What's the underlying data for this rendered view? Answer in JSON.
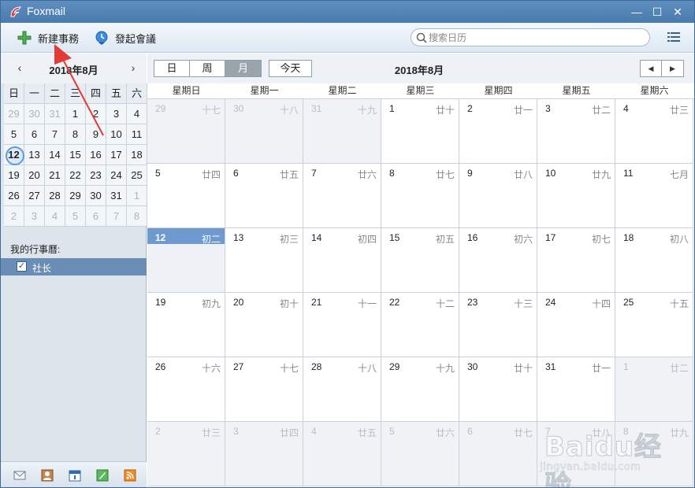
{
  "window": {
    "title": "Foxmail",
    "minimize": "—",
    "maximize": "☐",
    "close": "✕"
  },
  "toolbar": {
    "new_event": "新建事務",
    "start_meeting": "發起會議",
    "search_placeholder": "搜索日历"
  },
  "mini_calendar": {
    "title": "2018年8月",
    "prev": "‹",
    "next": "›",
    "weekdays": [
      "日",
      "一",
      "二",
      "三",
      "四",
      "五",
      "六"
    ],
    "weeks": [
      [
        {
          "d": "29",
          "o": true
        },
        {
          "d": "30",
          "o": true
        },
        {
          "d": "31",
          "o": true
        },
        {
          "d": "1"
        },
        {
          "d": "2"
        },
        {
          "d": "3"
        },
        {
          "d": "4"
        }
      ],
      [
        {
          "d": "5"
        },
        {
          "d": "6"
        },
        {
          "d": "7"
        },
        {
          "d": "8"
        },
        {
          "d": "9"
        },
        {
          "d": "10"
        },
        {
          "d": "11"
        }
      ],
      [
        {
          "d": "12",
          "t": true
        },
        {
          "d": "13"
        },
        {
          "d": "14"
        },
        {
          "d": "15"
        },
        {
          "d": "16"
        },
        {
          "d": "17"
        },
        {
          "d": "18"
        }
      ],
      [
        {
          "d": "19"
        },
        {
          "d": "20"
        },
        {
          "d": "21"
        },
        {
          "d": "22"
        },
        {
          "d": "23"
        },
        {
          "d": "24"
        },
        {
          "d": "25"
        }
      ],
      [
        {
          "d": "26"
        },
        {
          "d": "27"
        },
        {
          "d": "28"
        },
        {
          "d": "29"
        },
        {
          "d": "30"
        },
        {
          "d": "31"
        },
        {
          "d": "1",
          "o": true
        }
      ],
      [
        {
          "d": "2",
          "o": true
        },
        {
          "d": "3",
          "o": true
        },
        {
          "d": "4",
          "o": true
        },
        {
          "d": "5",
          "o": true
        },
        {
          "d": "6",
          "o": true
        },
        {
          "d": "7",
          "o": true
        },
        {
          "d": "8",
          "o": true
        }
      ]
    ]
  },
  "calendars": {
    "section_label": "我的行事曆:",
    "items": [
      {
        "label": "社长",
        "checked": true
      }
    ]
  },
  "view": {
    "day": "日",
    "week": "周",
    "month": "月",
    "today": "今天",
    "active": "month",
    "title": "2018年8月",
    "prev": "◀",
    "next": "▶"
  },
  "month_grid": {
    "weekdays": [
      "星期日",
      "星期一",
      "星期二",
      "星期三",
      "星期四",
      "星期五",
      "星期六"
    ],
    "weeks": [
      [
        {
          "d": "29",
          "l": "十七",
          "o": true
        },
        {
          "d": "30",
          "l": "十八",
          "o": true
        },
        {
          "d": "31",
          "l": "十九",
          "o": true
        },
        {
          "d": "1",
          "l": "廿十"
        },
        {
          "d": "2",
          "l": "廿一"
        },
        {
          "d": "3",
          "l": "廿二"
        },
        {
          "d": "4",
          "l": "廿三"
        }
      ],
      [
        {
          "d": "5",
          "l": "廿四"
        },
        {
          "d": "6",
          "l": "廿五"
        },
        {
          "d": "7",
          "l": "廿六"
        },
        {
          "d": "8",
          "l": "廿七"
        },
        {
          "d": "9",
          "l": "廿八"
        },
        {
          "d": "10",
          "l": "廿九"
        },
        {
          "d": "11",
          "l": "七月"
        }
      ],
      [
        {
          "d": "12",
          "l": "初二",
          "t": true
        },
        {
          "d": "13",
          "l": "初三"
        },
        {
          "d": "14",
          "l": "初四"
        },
        {
          "d": "15",
          "l": "初五"
        },
        {
          "d": "16",
          "l": "初六"
        },
        {
          "d": "17",
          "l": "初七"
        },
        {
          "d": "18",
          "l": "初八"
        }
      ],
      [
        {
          "d": "19",
          "l": "初九"
        },
        {
          "d": "20",
          "l": "初十"
        },
        {
          "d": "21",
          "l": "十一"
        },
        {
          "d": "22",
          "l": "十二"
        },
        {
          "d": "23",
          "l": "十三"
        },
        {
          "d": "24",
          "l": "十四"
        },
        {
          "d": "25",
          "l": "十五"
        }
      ],
      [
        {
          "d": "26",
          "l": "十六"
        },
        {
          "d": "27",
          "l": "十七"
        },
        {
          "d": "28",
          "l": "十八"
        },
        {
          "d": "29",
          "l": "十九"
        },
        {
          "d": "30",
          "l": "廿十"
        },
        {
          "d": "31",
          "l": "廿一"
        },
        {
          "d": "1",
          "l": "廿二",
          "o": true
        }
      ],
      [
        {
          "d": "2",
          "l": "廿三",
          "o": true
        },
        {
          "d": "3",
          "l": "廿四",
          "o": true
        },
        {
          "d": "4",
          "l": "廿五",
          "o": true
        },
        {
          "d": "5",
          "l": "廿六",
          "o": true
        },
        {
          "d": "6",
          "l": "廿七",
          "o": true
        },
        {
          "d": "7",
          "l": "廿八",
          "o": true
        },
        {
          "d": "8",
          "l": "廿九",
          "o": true
        }
      ]
    ]
  },
  "bottom_bar": {
    "icons": [
      "mail-icon",
      "contacts-icon",
      "calendar-icon",
      "notes-icon",
      "rss-icon"
    ],
    "active": "calendar-icon"
  },
  "watermark": {
    "text": "Baidu经验",
    "url": "jingyan.baidu.com"
  },
  "colors": {
    "titlebar": "#5f8fc0",
    "today_header": "#6f9ad0",
    "selected_calendar": "#6a8db5",
    "annotation_arrow": "#e53935"
  }
}
